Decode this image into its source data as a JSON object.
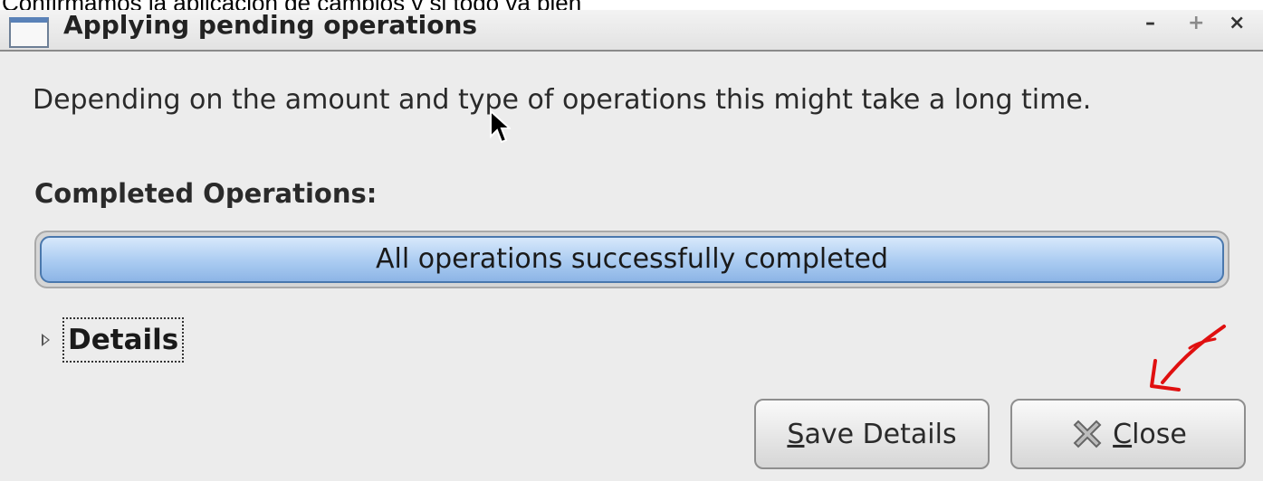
{
  "caption": "Confirmamos la aplicación de cambios y si todo va bien",
  "window": {
    "title": "Applying pending operations",
    "controls": {
      "minimize": "–",
      "maximize": "+",
      "close": "×"
    }
  },
  "message": "Depending on the amount and type of operations this might take a long time.",
  "completed_label": "Completed Operations:",
  "progress": {
    "text": "All operations successfully completed",
    "fraction": 1.0
  },
  "details": {
    "label": "Details",
    "expanded": false
  },
  "buttons": {
    "save": {
      "mnemonic": "S",
      "rest": "ave Details"
    },
    "close": {
      "mnemonic": "C",
      "rest": "lose"
    }
  },
  "colors": {
    "window_bg": "#ececec",
    "progress_fill": "#aacbf1",
    "progress_border": "#4a78ad",
    "annotation": "#e01010"
  }
}
